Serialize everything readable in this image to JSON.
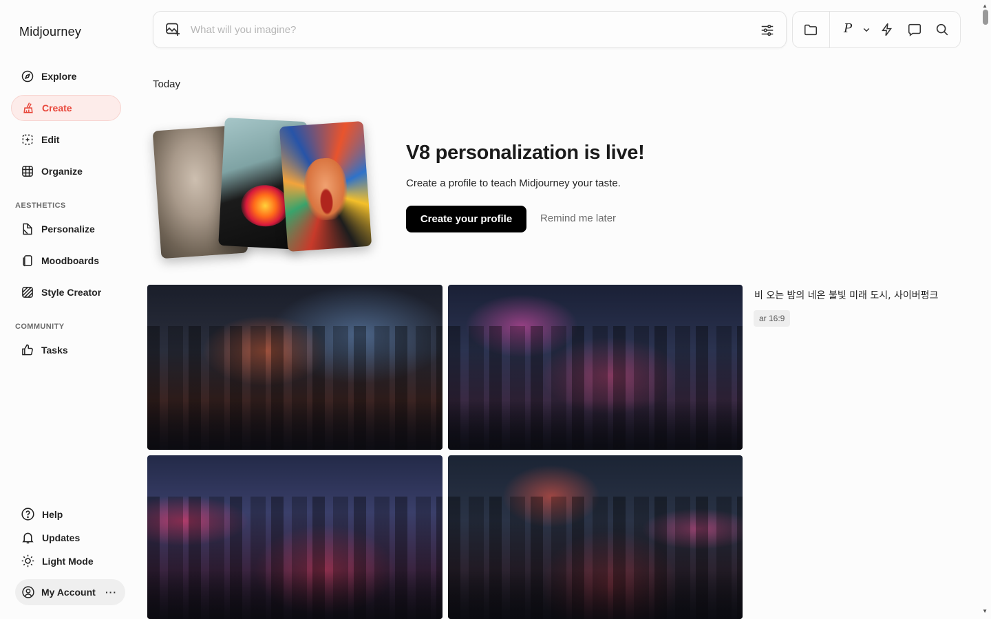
{
  "app": {
    "name": "Midjourney"
  },
  "sidebar": {
    "nav": [
      {
        "label": "Explore"
      },
      {
        "label": "Create"
      },
      {
        "label": "Edit"
      },
      {
        "label": "Organize"
      }
    ],
    "aesthetics_label": "AESTHETICS",
    "aesthetics": [
      {
        "label": "Personalize"
      },
      {
        "label": "Moodboards"
      },
      {
        "label": "Style Creator"
      }
    ],
    "community_label": "COMMUNITY",
    "community": [
      {
        "label": "Tasks"
      }
    ],
    "bottom": [
      {
        "label": "Help"
      },
      {
        "label": "Updates"
      },
      {
        "label": "Light Mode"
      }
    ],
    "account": {
      "label": "My Account",
      "more": "···"
    }
  },
  "search": {
    "placeholder": "What will you imagine?"
  },
  "tools": {
    "personalize_label": "P"
  },
  "content": {
    "section_title": "Today",
    "promo": {
      "title": "V8 personalization is live!",
      "subtitle": "Create a profile to teach Midjourney your taste.",
      "primary_button": "Create your profile",
      "secondary_button": "Remind me later"
    },
    "generation": {
      "prompt": "비 오는 밤의 네온 불빛 미래 도시, 사이버펑크",
      "params": [
        "ar 16:9"
      ],
      "image_count": 4
    }
  },
  "colors": {
    "accent": "#e8473b",
    "accent_bg": "#fdecea",
    "primary_button_bg": "#000000",
    "page_bg": "#fcfcfc"
  }
}
